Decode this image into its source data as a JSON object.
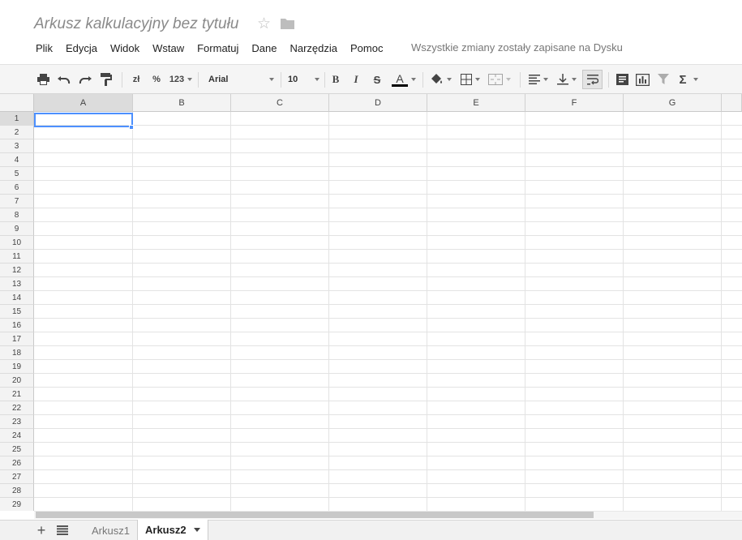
{
  "header": {
    "title": "Arkusz kalkulacyjny bez tytułu",
    "save_status": "Wszystkie zmiany zostały zapisane na Dysku"
  },
  "menu": [
    "Plik",
    "Edycja",
    "Widok",
    "Wstaw",
    "Formatuj",
    "Dane",
    "Narzędzia",
    "Pomoc"
  ],
  "toolbar": {
    "currency_label": "zł",
    "percent_label": "%",
    "number_format_label": "123",
    "font_family": "Arial",
    "font_size": "10",
    "bold_label": "B",
    "italic_label": "I",
    "strike_label": "S",
    "text_color_label": "A",
    "sum_label": "Σ"
  },
  "grid": {
    "columns": [
      "A",
      "B",
      "C",
      "D",
      "E",
      "F",
      "G"
    ],
    "rows": [
      "1",
      "2",
      "3",
      "4",
      "5",
      "6",
      "7",
      "8",
      "9",
      "10",
      "11",
      "12",
      "13",
      "14",
      "15",
      "16",
      "17",
      "18",
      "19",
      "20",
      "21",
      "22",
      "23",
      "24",
      "25",
      "26",
      "27",
      "28",
      "29"
    ],
    "active_cell": "A1"
  },
  "sheets": {
    "tabs": [
      "Arkusz1",
      "Arkusz2"
    ],
    "active": "Arkusz2"
  },
  "colors": {
    "accent": "#4d90fe"
  }
}
